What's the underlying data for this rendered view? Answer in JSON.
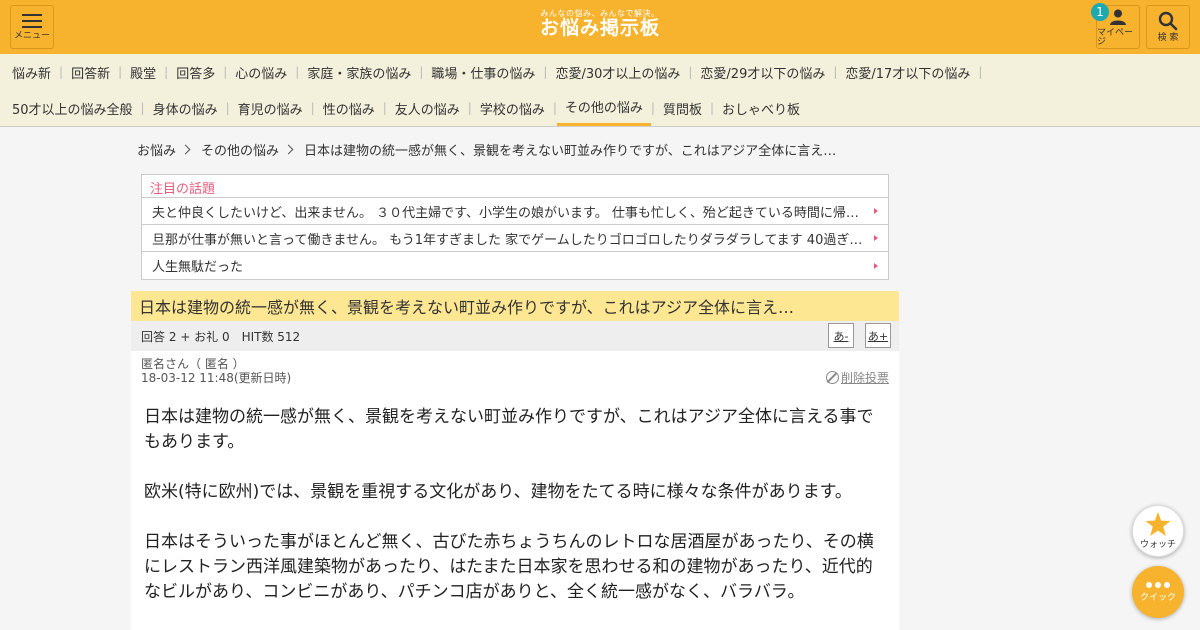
{
  "header": {
    "menu_label": "メニュー",
    "logo_tagline": "みんなの悩み、みんなで解決。",
    "logo_name": "お悩み掲示板",
    "mypage_label": "マイページ",
    "mypage_badge": "1",
    "search_label": "検 索",
    "colors": {
      "brand": "#f7b32e",
      "badge": "#1ca9b0"
    }
  },
  "categories": {
    "row1": [
      "悩み新",
      "回答新",
      "殿堂",
      "回答多",
      "心の悩み",
      "家庭・家族の悩み",
      "職場・仕事の悩み",
      "恋愛/30才以上の悩み",
      "恋愛/29才以下の悩み",
      "恋愛/17才以下の悩み"
    ],
    "row2": [
      "50才以上の悩み全般",
      "身体の悩み",
      "育児の悩み",
      "性の悩み",
      "友人の悩み",
      "学校の悩み",
      "その他の悩み",
      "質問板",
      "おしゃべり板"
    ],
    "active": "その他の悩み"
  },
  "breadcrumb": [
    "お悩み",
    "その他の悩み",
    "日本は建物の統一感が無く、景観を考えない町並み作りですが、これはアジア全体に言え…"
  ],
  "featured": {
    "title": "注目の話題",
    "items": [
      "夫と仲良くしたいけど、出来ません。 ３０代主婦です、小学生の娘がいます。 仕事も忙しく、殆ど起きている時間に帰っ…",
      "旦那が仕事が無いと言って働きません。 もう1年すぎました 家でゲームしたりゴロゴロしたりダラダラしてます 40過ぎな…",
      "人生無駄だった"
    ]
  },
  "post": {
    "title": "日本は建物の統一感が無く、景観を考えない町並み作りですが、これはアジア全体に言え…",
    "stats": "回答 2 + お礼 0　HIT数 512",
    "font_small": "あ-",
    "font_large": "あ+",
    "author": "匿名さん（ 匿名 ）",
    "date": "18-03-12 11:48(更新日時)",
    "delete_label": "削除投票",
    "paragraphs": [
      "日本は建物の統一感が無く、景観を考えない町並み作りですが、これはアジア全体に言える事でもあります。",
      "欧米(特に欧州)では、景観を重視する文化があり、建物をたてる時に様々な条件があります。",
      "日本はそういった事がほとんど無く、古びた赤ちょうちんのレトロな居酒屋があったり、その横にレストラン西洋風建築物があったり、はたまた日本家を思わせる和の建物があったり、近代的なビルがあり、コンビニがあり、パチンコ店がありと、全く統一感がなく、バラバラ。"
    ]
  },
  "floating": {
    "watch_label": "ウォッチ",
    "quick_label": "クイック"
  }
}
